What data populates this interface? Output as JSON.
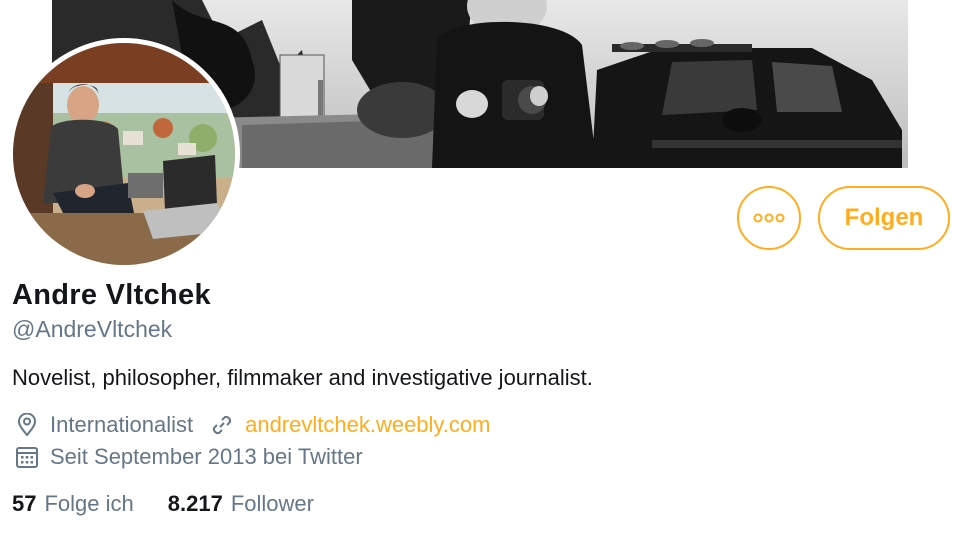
{
  "profile": {
    "display_name": "Andre Vltchek",
    "handle": "@AndreVltchek",
    "bio": "Novelist, philosopher, filmmaker and investigative journalist.",
    "location": "Internationalist",
    "website": "andrevltchek.weebly.com",
    "joined": "Seit September 2013 bei Twitter"
  },
  "stats": {
    "following_count": "57",
    "following_label": "Folge ich",
    "followers_count": "8.217",
    "followers_label": "Follower"
  },
  "actions": {
    "follow_label": "Folgen",
    "more_icon": "more-dots-icon"
  },
  "icons": {
    "location": "location-pin-icon",
    "website": "link-icon",
    "joined": "calendar-icon"
  },
  "colors": {
    "accent": "#ffad1f",
    "text": "#14171a",
    "secondary": "#657786"
  }
}
